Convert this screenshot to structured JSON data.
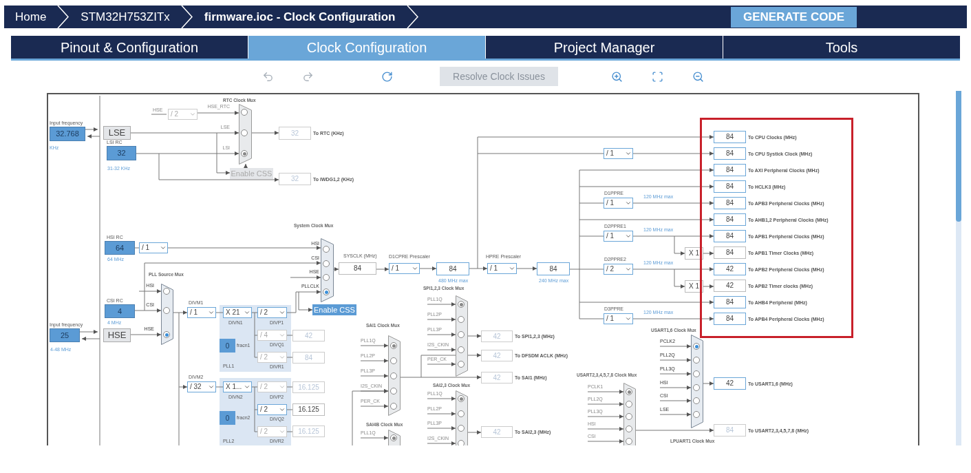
{
  "breadcrumb": [
    {
      "label": "Home",
      "selected": false
    },
    {
      "label": "STM32H753ZITx",
      "selected": false
    },
    {
      "label": "firmware.ioc - Clock Configuration",
      "selected": true
    }
  ],
  "generate_button": "GENERATE CODE",
  "tabs": [
    {
      "label": "Pinout & Configuration",
      "selected": false
    },
    {
      "label": "Clock Configuration",
      "selected": true
    },
    {
      "label": "Project Manager",
      "selected": false
    },
    {
      "label": "Tools",
      "selected": false
    }
  ],
  "toolbar": {
    "resolve_button": {
      "label": "Resolve Clock Issues",
      "disabled": true
    }
  },
  "diagram": {
    "sources": [
      {
        "caption": "Input frequency",
        "value": "32.768",
        "unit": "KHz"
      },
      {
        "caption": "LSI RC",
        "value": "32",
        "unit": "31-32 KHz"
      },
      {
        "caption": "HSI RC",
        "value": "64",
        "unit": "64 MHz"
      },
      {
        "caption": "CSI RC",
        "value": "4",
        "unit": "4 MHz"
      },
      {
        "caption": "Input frequency",
        "value": "25",
        "unit": "4-48 MHz"
      }
    ],
    "oscillators": [
      "LSE",
      "HSE"
    ],
    "wire_labels": [
      "HSE"
    ],
    "pll_blocks": [
      {
        "label": "PLL1",
        "fraction": "0",
        "fraction_label": "fracn1"
      },
      {
        "label": "PLL2",
        "fraction": "0",
        "fraction_label": "fracn2"
      }
    ],
    "css_buttons": [
      {
        "label": "Enable CSS",
        "active": false
      },
      {
        "label": "Enable CSS",
        "active": true
      }
    ],
    "prescalers": [
      {
        "value": "/ 2",
        "active": false
      },
      {
        "value": "/ 1",
        "active": true
      },
      {
        "caption": "D1CPRE Prescaler",
        "value": "/ 1",
        "active": true
      },
      {
        "caption": "HPRE Prescaler",
        "value": "/ 1",
        "active": true
      },
      {
        "value": "/ 1",
        "active": true
      },
      {
        "caption": "D1PPRE",
        "value": "/ 1",
        "active": true,
        "note": "120 MHz max"
      },
      {
        "caption": "D2PPRE1",
        "value": "/ 1",
        "active": true,
        "note": "120 MHz max"
      },
      {
        "caption": "D2PPRE2",
        "value": "/ 2",
        "active": true,
        "note": "120 MHz max"
      },
      {
        "caption": "D3PPRE",
        "value": "/ 1",
        "active": true,
        "note": "120 MHz max"
      },
      {
        "caption": "DIVM1",
        "value": "/ 1",
        "active": true
      },
      {
        "caption": "DIVN1",
        "value": "X 21",
        "active": true
      },
      {
        "caption": "DIVP1",
        "value": "/ 2",
        "active": true
      },
      {
        "caption": "DIVQ1",
        "value": "/ 4",
        "active": false
      },
      {
        "caption": "DIVR1",
        "value": "/ 2",
        "active": false
      },
      {
        "caption": "DIVM2",
        "value": "/ 32",
        "active": true
      },
      {
        "caption": "DIVN2",
        "value": "X 1...",
        "active": true
      },
      {
        "caption": "DIVP2",
        "value": "/ 2",
        "active": false
      },
      {
        "caption": "DIVQ2",
        "value": "/ 2",
        "active": true
      },
      {
        "caption": "DIVR2",
        "value": "/ 2",
        "active": false
      }
    ],
    "outputs": [
      {
        "value": "32",
        "label": "To RTC (KHz)",
        "highlighted": false,
        "disabled": true
      },
      {
        "value": "32",
        "label": "To IWDG1,2 (KHz)",
        "highlighted": false,
        "disabled": true
      },
      {
        "caption": "SYSCLK (MHz)",
        "value": "84",
        "highlighted": false,
        "disabled": false
      },
      {
        "value": "84",
        "note": "480 MHz max",
        "highlighted": true,
        "disabled": false
      },
      {
        "value": "84",
        "note": "240 MHz max",
        "highlighted": true,
        "disabled": false
      },
      {
        "value": "X 1",
        "highlighted": false,
        "disabled": false
      },
      {
        "value": "X 1",
        "highlighted": false,
        "disabled": false
      },
      {
        "value": "84",
        "label": "To CPU Clocks (MHz)",
        "highlighted": true,
        "disabled": false
      },
      {
        "value": "84",
        "label": "To CPU Systick Clock (MHz)",
        "highlighted": true,
        "disabled": false
      },
      {
        "value": "84",
        "label": "To AXI Peripheral Clocks (MHz)",
        "highlighted": true,
        "disabled": false
      },
      {
        "value": "84",
        "label": "To HCLK3 (MHz)",
        "highlighted": true,
        "disabled": false
      },
      {
        "value": "84",
        "label": "To APB3 Peripheral Clocks (MHz)",
        "highlighted": true,
        "disabled": false
      },
      {
        "value": "84",
        "label": "To AHB1,2 Peripheral Clocks (MHz)",
        "highlighted": true,
        "disabled": false
      },
      {
        "value": "84",
        "label": "To APB1 Peripheral Clocks (MHz)",
        "highlighted": true,
        "disabled": false
      },
      {
        "value": "84",
        "label": "To APB1 Timer Clocks (MHz)",
        "highlighted": false,
        "disabled": false
      },
      {
        "value": "42",
        "label": "To APB2 Peripheral Clocks (MHz)",
        "highlighted": true,
        "disabled": false
      },
      {
        "value": "42",
        "label": "To APB2 Timer clocks (MHz)",
        "highlighted": false,
        "disabled": false
      },
      {
        "value": "84",
        "label": "To AHB4 Peripheral (MHz)",
        "highlighted": true,
        "disabled": false
      },
      {
        "value": "84",
        "label": "To APB4 Peripheral Clocks (MHz)",
        "highlighted": true,
        "disabled": false
      },
      {
        "value": "42",
        "highlighted": false,
        "disabled": true
      },
      {
        "value": "84",
        "highlighted": false,
        "disabled": true
      },
      {
        "value": "16.125",
        "highlighted": false,
        "disabled": true
      },
      {
        "value": "16.125",
        "highlighted": false,
        "disabled": false
      },
      {
        "value": "16.125",
        "highlighted": false,
        "disabled": true
      },
      {
        "value": "42",
        "label": "To SPI1,2,3 (MHz)",
        "highlighted": false,
        "disabled": true
      },
      {
        "value": "42",
        "label": "To DFSDM ACLK (MHz)",
        "highlighted": false,
        "disabled": true
      },
      {
        "value": "42",
        "label": "To SAI1 (MHz)",
        "highlighted": false,
        "disabled": true
      },
      {
        "value": "42",
        "label": "To SAI2,3 (MHz)",
        "highlighted": false,
        "disabled": true
      },
      {
        "value": "42",
        "label": "To USART1,6 (MHz)",
        "highlighted": true,
        "disabled": false
      },
      {
        "value": "84",
        "label": "To USART2,3,4,5,7,8 (MHz)",
        "highlighted": false,
        "disabled": true
      }
    ],
    "muxes": [
      {
        "title": "RTC Clock Mux",
        "active": false,
        "inputs": [
          {
            "label": "HSE_RTC",
            "selected": false
          },
          {
            "label": "LSE",
            "selected": false
          },
          {
            "label": "LSI",
            "selected": true
          }
        ]
      },
      {
        "title": "System Clock Mux",
        "active": true,
        "inputs": [
          {
            "label": "HSI",
            "selected": false
          },
          {
            "label": "CSI",
            "selected": false
          },
          {
            "label": "HSE",
            "selected": false
          },
          {
            "label": "PLLCLK",
            "selected": true
          }
        ]
      },
      {
        "title": "PLL Source Mux",
        "active": true,
        "inputs": [
          {
            "label": "HSI",
            "selected": false
          },
          {
            "label": "CSI",
            "selected": false
          },
          {
            "label": "HSE",
            "selected": true
          }
        ]
      },
      {
        "title": "SPI1,2,3 Clock Mux",
        "active": false,
        "inputs": [
          {
            "label": "PLL1Q",
            "selected": true
          },
          {
            "label": "PLL2P",
            "selected": false
          },
          {
            "label": "PLL3P",
            "selected": false
          },
          {
            "label": "I2S_CKIN",
            "selected": false
          },
          {
            "label": "PER_CK",
            "selected": false
          }
        ]
      },
      {
        "title": "SAI1 Clock Mux",
        "active": false,
        "inputs": [
          {
            "label": "PLL1Q",
            "selected": true
          },
          {
            "label": "PLL2P",
            "selected": false
          },
          {
            "label": "PLL3P",
            "selected": false
          },
          {
            "label": "I2S_CKIN",
            "selected": false
          },
          {
            "label": "PER_CK",
            "selected": false
          }
        ]
      },
      {
        "title": "SAI2,3 Clock Mux",
        "active": false,
        "inputs": [
          {
            "label": "PLL1Q",
            "selected": true
          },
          {
            "label": "PLL2P",
            "selected": false
          },
          {
            "label": "PLL3P",
            "selected": false
          },
          {
            "label": "I2S_CKIN",
            "selected": false
          }
        ]
      },
      {
        "title": "SAI4B Clock Mux",
        "active": false,
        "inputs": [
          {
            "label": "PLL1Q",
            "selected": true
          }
        ]
      },
      {
        "title": "USART1,6 Clock Mux",
        "active": true,
        "inputs": [
          {
            "label": "PCLK2",
            "selected": true
          },
          {
            "label": "PLL2Q",
            "selected": false
          },
          {
            "label": "PLL3Q",
            "selected": false
          },
          {
            "label": "HSI",
            "selected": false
          },
          {
            "label": "CSI",
            "selected": false
          },
          {
            "label": "LSE",
            "selected": false
          }
        ]
      },
      {
        "title": "USART2,3,4,5,7,8 Clock Mux",
        "active": false,
        "inputs": [
          {
            "label": "PCLK1",
            "selected": true
          },
          {
            "label": "PLL2Q",
            "selected": false
          },
          {
            "label": "PLL3Q",
            "selected": false
          },
          {
            "label": "HSI",
            "selected": false
          },
          {
            "label": "CSI",
            "selected": false
          }
        ]
      },
      {
        "title": "LPUART1 Clock Mux"
      }
    ]
  }
}
